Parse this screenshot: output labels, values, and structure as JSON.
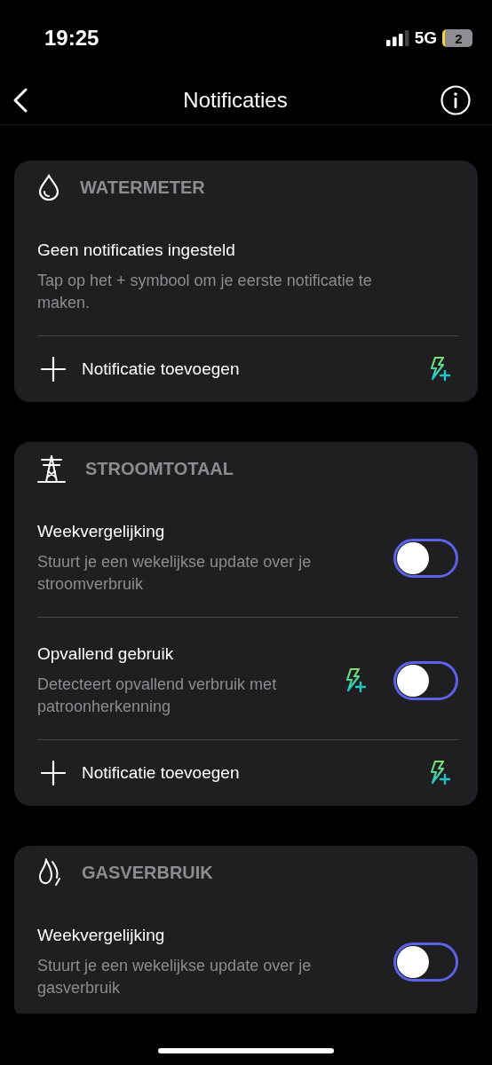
{
  "status_bar": {
    "time": "19:25",
    "network": "5G",
    "battery": "2"
  },
  "nav": {
    "title": "Notificaties"
  },
  "sections": [
    {
      "kind": "drop",
      "title": "WATERMETER",
      "items": [
        {
          "kind": "empty",
          "title": "Geen notificaties ingesteld",
          "description": "Tap op het + symbool om je eerste notificatie te maken."
        },
        {
          "kind": "add",
          "label": "Notificatie toevoegen",
          "premium": true
        }
      ]
    },
    {
      "kind": "pylon",
      "title": "STROOMTOTAAL",
      "items": [
        {
          "kind": "toggle",
          "title": "Weekvergelijking",
          "description": "Stuurt je een wekelijkse update over je stroomverbruik",
          "on": false,
          "premium": false
        },
        {
          "kind": "toggle",
          "title": "Opvallend gebruik",
          "description": "Detecteert opvallend verbruik met patroonherkenning",
          "on": false,
          "premium": true
        },
        {
          "kind": "add",
          "label": "Notificatie toevoegen",
          "premium": true
        }
      ]
    },
    {
      "kind": "flame",
      "title": "GASVERBRUIK",
      "items": [
        {
          "kind": "toggle",
          "title": "Weekvergelijking",
          "description": "Stuurt je een wekelijkse update over je gasverbruik",
          "on": false,
          "premium": false
        }
      ]
    }
  ]
}
